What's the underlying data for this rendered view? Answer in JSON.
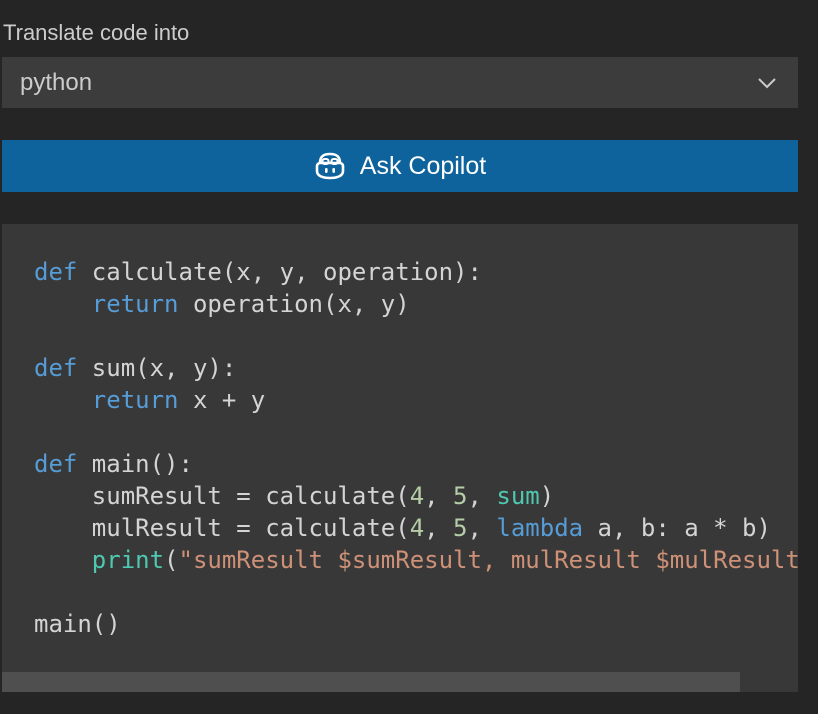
{
  "translate": {
    "label": "Translate code into",
    "selected_language": "python"
  },
  "button": {
    "label": "Ask Copilot",
    "icon": "copilot-icon"
  },
  "colors": {
    "background": "#252526",
    "select_bg": "#3c3c3c",
    "button_bg": "#0e639c",
    "code_bg": "#383838",
    "keyword": "#569cd6",
    "builtin": "#4ec9b0",
    "number": "#b5cea8",
    "string": "#ce9178"
  },
  "code": {
    "lines": [
      [
        {
          "t": "def",
          "c": "kw"
        },
        {
          "t": " calculate(x, y, operation):",
          "c": "plain"
        }
      ],
      [
        {
          "t": "    ",
          "c": "plain"
        },
        {
          "t": "return",
          "c": "kw"
        },
        {
          "t": " operation(x, y)",
          "c": "plain"
        }
      ],
      [],
      [
        {
          "t": "def",
          "c": "kw"
        },
        {
          "t": " sum(x, y):",
          "c": "plain"
        }
      ],
      [
        {
          "t": "    ",
          "c": "plain"
        },
        {
          "t": "return",
          "c": "kw"
        },
        {
          "t": " x + y",
          "c": "plain"
        }
      ],
      [],
      [
        {
          "t": "def",
          "c": "kw"
        },
        {
          "t": " main():",
          "c": "plain"
        }
      ],
      [
        {
          "t": "    sumResult = calculate(",
          "c": "plain"
        },
        {
          "t": "4",
          "c": "num"
        },
        {
          "t": ", ",
          "c": "plain"
        },
        {
          "t": "5",
          "c": "num"
        },
        {
          "t": ", ",
          "c": "plain"
        },
        {
          "t": "sum",
          "c": "fn"
        },
        {
          "t": ")",
          "c": "plain"
        }
      ],
      [
        {
          "t": "    mulResult = calculate(",
          "c": "plain"
        },
        {
          "t": "4",
          "c": "num"
        },
        {
          "t": ", ",
          "c": "plain"
        },
        {
          "t": "5",
          "c": "num"
        },
        {
          "t": ", ",
          "c": "plain"
        },
        {
          "t": "lambda",
          "c": "kw"
        },
        {
          "t": " a, b: a * b)",
          "c": "plain"
        }
      ],
      [
        {
          "t": "    ",
          "c": "plain"
        },
        {
          "t": "print",
          "c": "fn"
        },
        {
          "t": "(",
          "c": "plain"
        },
        {
          "t": "\"sumResult $sumResult, mulResult $mulResult",
          "c": "str"
        }
      ],
      [],
      [
        {
          "t": "main()",
          "c": "plain"
        }
      ]
    ]
  }
}
